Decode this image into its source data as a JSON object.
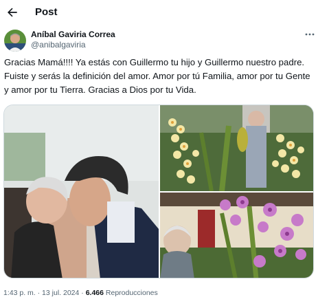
{
  "header": {
    "title": "Post"
  },
  "author": {
    "name": "Aníbal Gaviria Correa",
    "handle": "@anibalgaviria"
  },
  "post": {
    "text": "Gracias Mamá!!!!  Ya estás con Guillermo tu hijo y Guillermo nuestro padre. Fuiste y serás la definición del amor. Amor por tú Familia, amor por tu Gente y amor por tu Tierra. Gracias a Dios por tu Vida."
  },
  "meta": {
    "time": "1:43 p. m.",
    "separator": "·",
    "date": "13 jul. 2024",
    "views": "6.466",
    "views_label": "Reproducciones"
  },
  "icons": {
    "back": "arrow-left-icon",
    "more": "more-horizontal-icon"
  },
  "colors": {
    "text": "#0f1419",
    "secondary": "#536471",
    "border": "#cfd9de"
  }
}
